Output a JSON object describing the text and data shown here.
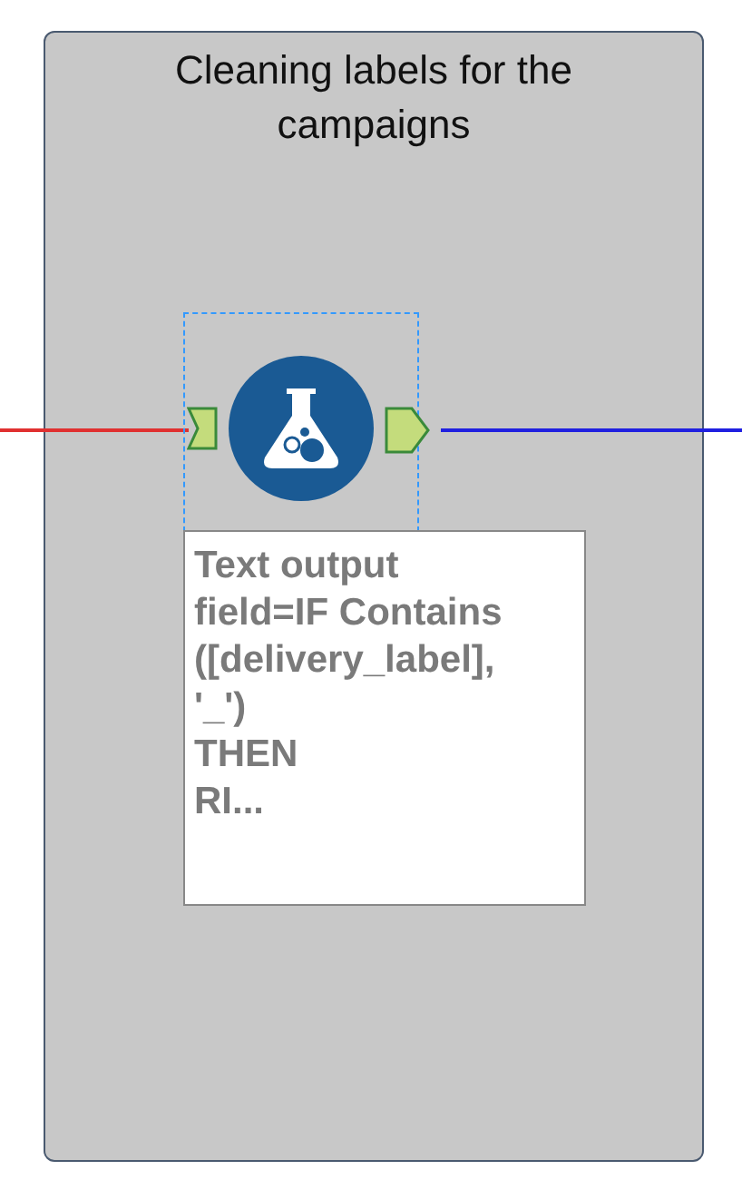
{
  "container": {
    "title": "Cleaning labels for the campaigns"
  },
  "tool": {
    "selected": true,
    "annotation": "Text output\nfield=IF Contains\n([delivery_label],\n'_')\nTHEN\nRI..."
  },
  "connections": [
    {
      "kind": "incoming",
      "color": "#e03030"
    },
    {
      "kind": "outgoing",
      "color": "#2020e0"
    }
  ]
}
